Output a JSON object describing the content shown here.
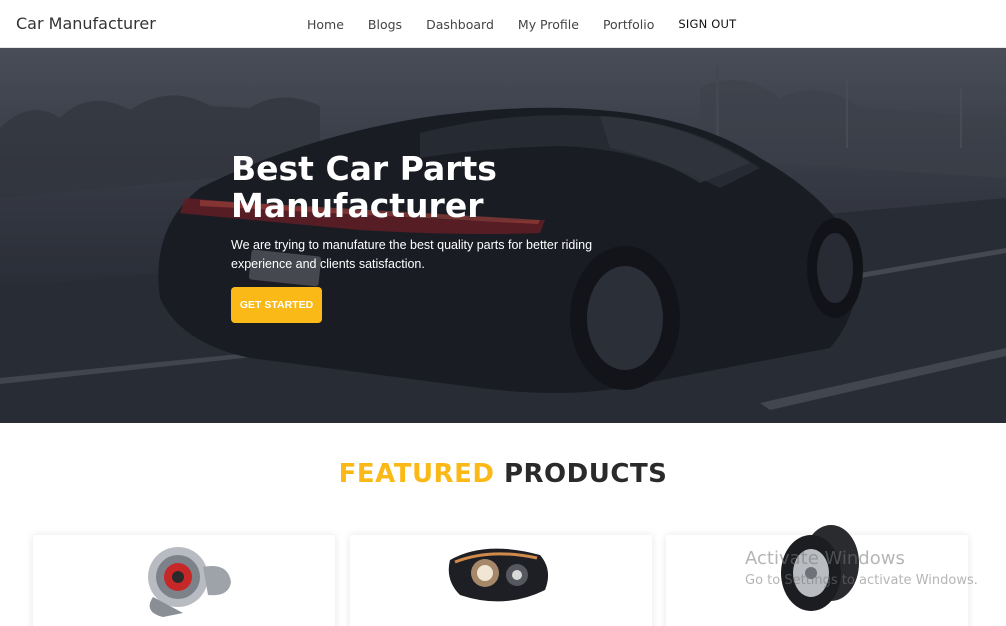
{
  "brand": "Car Manufacturer",
  "nav": {
    "links": [
      "Home",
      "Blogs",
      "Dashboard",
      "My Profile",
      "Portfolio"
    ],
    "signout": "SIGN OUT"
  },
  "hero": {
    "title": "Best Car Parts Manufacturer",
    "subtitle": "We are trying to manufature the best quality parts for better riding experience and clients satisfaction.",
    "cta": "GET STARTED"
  },
  "featured": {
    "accent_word": "FEATURED",
    "rest_word": "PRODUCTS",
    "products": [
      {
        "icon": "turbocharger-icon"
      },
      {
        "icon": "headlight-icon"
      },
      {
        "icon": "tires-icon"
      }
    ]
  },
  "watermark": {
    "title": "Activate Windows",
    "subtitle": "Go to Settings to activate Windows."
  },
  "colors": {
    "accent": "#fbb917",
    "hero_dark": "#2d3039"
  }
}
